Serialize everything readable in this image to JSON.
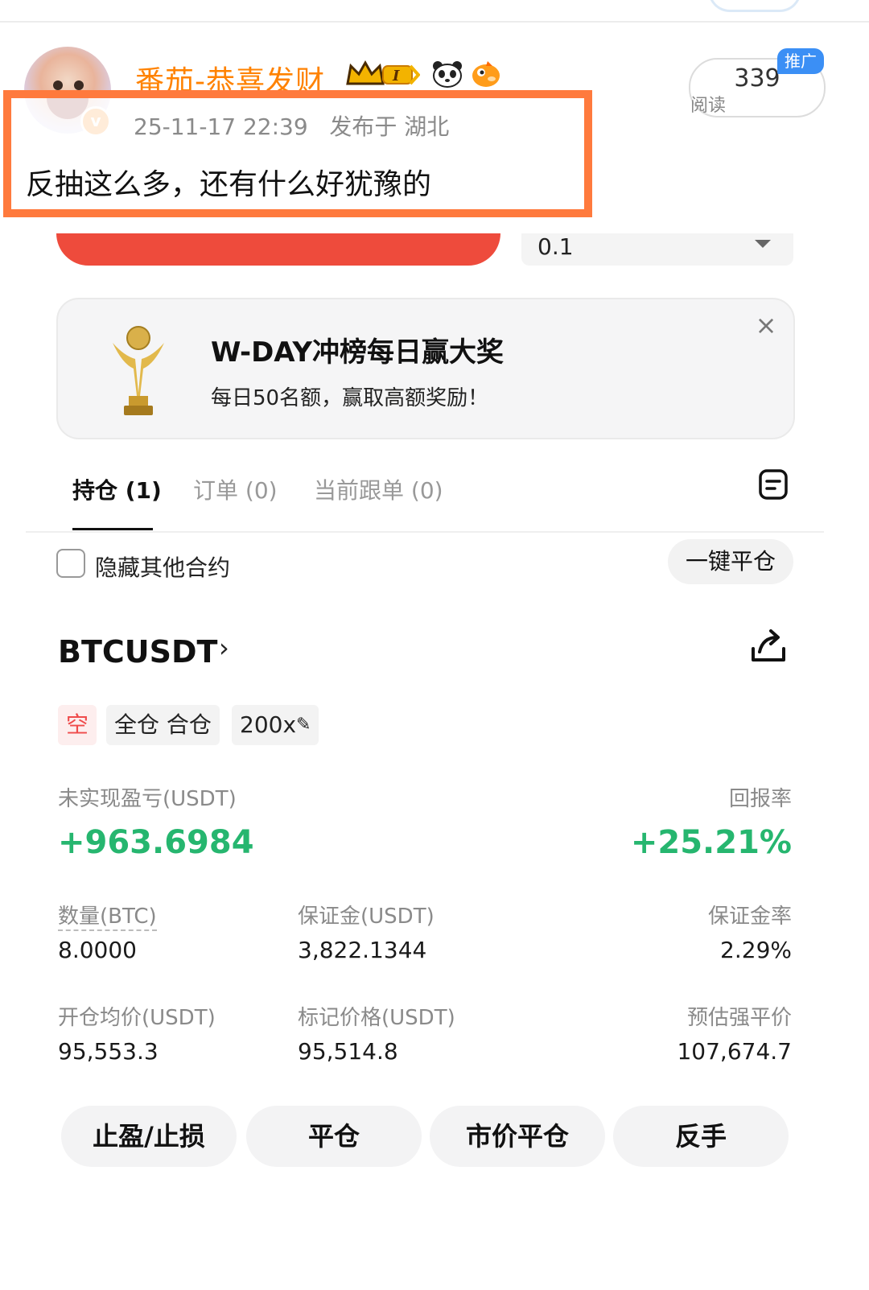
{
  "post": {
    "username": "番茄-恭喜发财",
    "level_badge": "I",
    "timestamp": "25-11-17 22:39",
    "location": "发布于 湖北",
    "text": "反抽这么多，还有什么好犹豫的",
    "read_count": "339",
    "read_label": "阅读",
    "promo_label": "推广"
  },
  "trade": {
    "qty_value": "0.1",
    "banner": {
      "title": "W-DAY冲榜每日赢大奖",
      "subtitle": "每日50名额，赢取高额奖励！",
      "close": "×"
    },
    "tabs": [
      "持仓 (1)",
      "订单 (0)",
      "当前跟单 (0)"
    ],
    "hide_other": "隐藏其他合约",
    "close_all": "一键平仓",
    "position": {
      "symbol": "BTCUSDT",
      "chevron": "›",
      "tags": [
        "空",
        "全仓 合仓",
        "200x"
      ],
      "unrealized_label": "未实现盈亏(USDT)",
      "unrealized_value": "+963.6984",
      "roe_label": "回报率",
      "roe_value": "+25.21%",
      "qty_label": "数量(BTC)",
      "qty_value": "8.0000",
      "margin_label": "保证金(USDT)",
      "margin_value": "3,822.1344",
      "margin_ratio_label": "保证金率",
      "margin_ratio_value": "2.29%",
      "entry_label": "开仓均价(USDT)",
      "entry_value": "95,553.3",
      "mark_label": "标记价格(USDT)",
      "mark_value": "95,514.8",
      "liq_label": "预估强平价",
      "liq_value": "107,674.7"
    },
    "actions": [
      "止盈/止损",
      "平仓",
      "市价平仓",
      "反手"
    ]
  },
  "colors": {
    "weibo_orange": "#ff8200",
    "highlight_border": "#ff7a3d",
    "profit_green": "#26b66f",
    "sell_red": "#ee4b3c",
    "promo_blue": "#3b8ff5"
  }
}
